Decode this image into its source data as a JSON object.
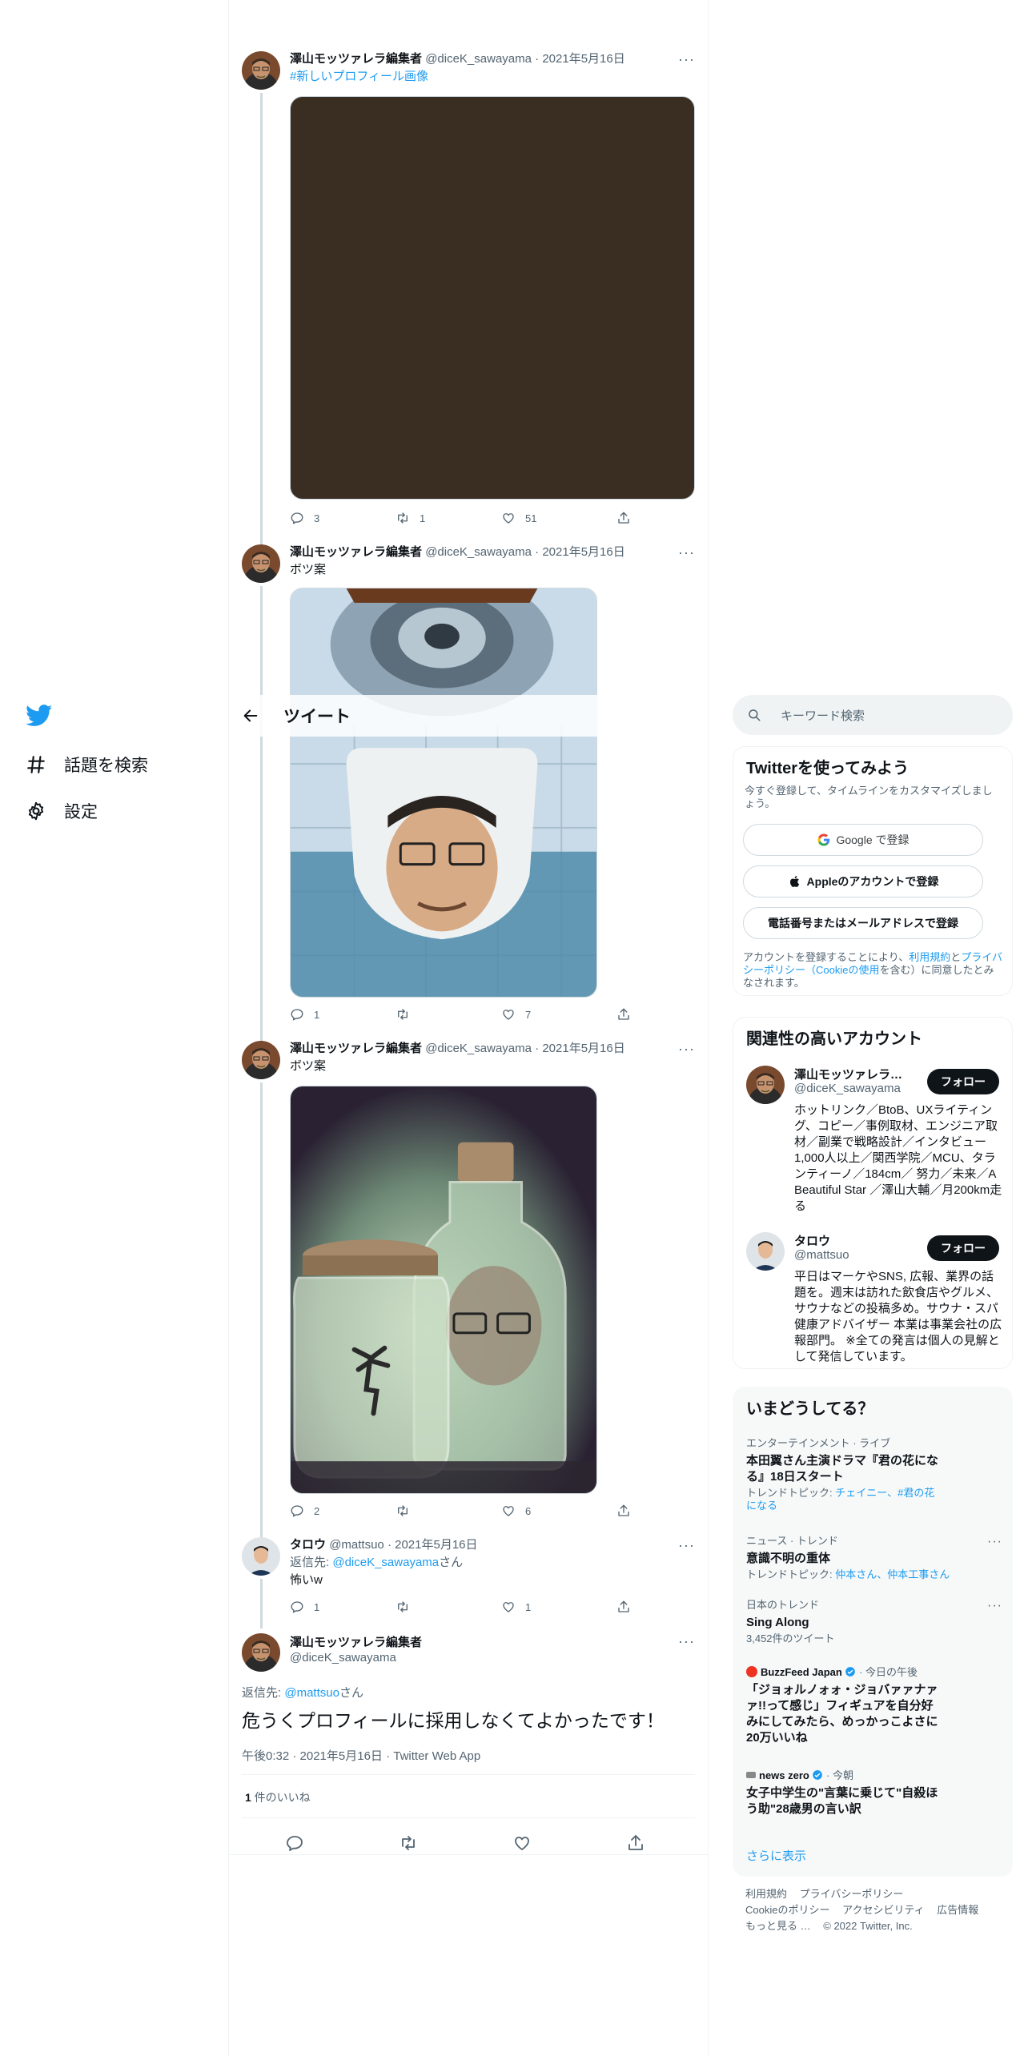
{
  "nav": {
    "explore_label": "話題を検索",
    "settings_label": "設定"
  },
  "header": {
    "title": "ツイート"
  },
  "tweets": [
    {
      "name": "澤山モッツァレラ編集者",
      "handle": "@diceK_sawayama",
      "date": "2021年5月16日",
      "text": "#新しいプロフィール画像",
      "reply_count": "3",
      "retweet_count": "1",
      "like_count": "51"
    },
    {
      "name": "澤山モッツァレラ編集者",
      "handle": "@diceK_sawayama",
      "date": "2021年5月16日",
      "text": "ボツ案",
      "reply_count": "1",
      "retweet_count": "",
      "like_count": "7"
    },
    {
      "name": "澤山モッツァレラ編集者",
      "handle": "@diceK_sawayama",
      "date": "2021年5月16日",
      "text": "ボツ案",
      "reply_count": "2",
      "retweet_count": "",
      "like_count": "6"
    },
    {
      "name": "タロウ",
      "handle": "@mattsuo",
      "date": "2021年5月16日",
      "reply_prefix": "返信先: ",
      "reply_to": "@diceK_sawayama",
      "reply_suffix": "さん",
      "text": "怖いw",
      "reply_count": "1",
      "retweet_count": "",
      "like_count": "1"
    }
  ],
  "focal": {
    "name": "澤山モッツァレラ編集者",
    "handle": "@diceK_sawayama",
    "reply_prefix": "返信先: ",
    "reply_to": "@mattsuo",
    "reply_suffix": "さん",
    "text": "危うくプロフィールに採用しなくてよかったです！",
    "meta": "午後0:32 · 2021年5月16日 · Twitter Web App",
    "likes_count": "1",
    "likes_label": " 件のいいね"
  },
  "search": {
    "placeholder": "キーワード検索"
  },
  "signup": {
    "title": "Twitterを使ってみよう",
    "subtitle": "今すぐ登録して、タイムラインをカスタマイズしましょう。",
    "google_label": "Google で登録",
    "apple_label": "Appleのアカウントで登録",
    "phone_label": "電話番号またはメールアドレスで登録",
    "legal_prefix": "アカウントを登録することにより、",
    "legal_terms": "利用規約",
    "legal_and": "と",
    "legal_privacy": "プライバシーポリシー（Cookieの使用",
    "legal_suffix": "を含む）に同意したとみなされます。"
  },
  "accounts": {
    "title": "関連性の高いアカウント",
    "follow_label": "フォロー",
    "items": [
      {
        "name": "澤山モッツァレラ編集者",
        "handle": "@diceK_sawayama",
        "bio": "ホットリンク／BtoB、UXライティング、コピー／事例取材、エンジニア取材／副業で戦略設計／インタビュー1,000人以上／関西学院／MCU、タランティーノ／184cm／ 努力／未来／A Beautiful Star ／澤山大輔／月200km走る"
      },
      {
        "name": "タロウ",
        "handle": "@mattsuo",
        "bio": "平日はマーケやSNS, 広報、業界の話題を。週末は訪れた飲食店やグルメ、サウナなどの投稿多め。サウナ・スパ健康アドバイザー 本業は事業会社の広報部門。 ※全ての発言は個人の見解として発信しています。"
      }
    ]
  },
  "trends": {
    "title": "いまどうしてる？",
    "items": [
      {
        "category": "エンターテインメント · ライブ",
        "title": "本田翼さん主演ドラマ『君の花になる』18日スタート",
        "sub_prefix": "トレンドトピック: ",
        "sub_links": "チェイニー、#君の花になる",
        "sub_plain": ""
      },
      {
        "category": "ニュース · トレンド",
        "title": "意識不明の重体",
        "sub_prefix": "トレンドトピック: ",
        "sub_links": "仲本さん、仲本工事さん",
        "sub_plain": ""
      },
      {
        "category": "日本のトレンド",
        "title": "Sing Along",
        "sub_prefix": "",
        "sub_links": "",
        "sub_plain": "3,452件のツイート"
      },
      {
        "source": "BuzzFeed Japan",
        "time": " · 今日の午後",
        "title": "「ジョォルノォォ・ジョバァァナァァ!!って感じ」フィギュアを自分好みにしてみたら、めっかっこよさに20万いいね"
      },
      {
        "source": "news zero",
        "time": " · 今朝",
        "title": "女子中学生の\"言葉に乗じて\"自殺ほう助\"28歳男の言い訳"
      }
    ],
    "show_more": "さらに表示"
  },
  "footer": {
    "links": [
      "利用規約",
      "プライバシーポリシー",
      "Cookieのポリシー",
      "アクセシビリティ",
      "広告情報",
      "もっと見る …"
    ],
    "copyright": "© 2022 Twitter, Inc."
  },
  "colors": {
    "accent": "#1d9bf0",
    "text_primary": "#0f1419",
    "text_secondary": "#536471",
    "border": "#eff3f4",
    "first_media_bg": "#3a2e22"
  }
}
